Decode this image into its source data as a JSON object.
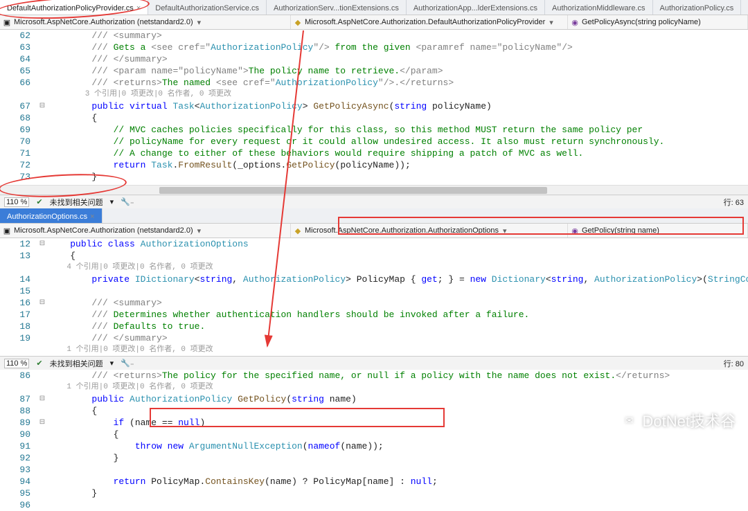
{
  "tabs_top": [
    {
      "label": "DefaultAuthorizationPolicyProvider.cs",
      "active": true,
      "closeable": true
    },
    {
      "label": "DefaultAuthorizationService.cs"
    },
    {
      "label": "AuthorizationServ...tionExtensions.cs"
    },
    {
      "label": "AuthorizationApp...lderExtensions.cs"
    },
    {
      "label": "AuthorizationMiddleware.cs"
    },
    {
      "label": "AuthorizationPolicy.cs"
    }
  ],
  "nav_top": {
    "left": "Microsoft.AspNetCore.Authorization (netstandard2.0)",
    "mid": "Microsoft.AspNetCore.Authorization.DefaultAuthorizationPolicyProvider",
    "right": "GetPolicyAsync(string policyName)"
  },
  "pane1": {
    "lines": [
      {
        "n": 62,
        "codelens": null,
        "html": "<span class='c-xml'>/// &lt;summary&gt;</span>"
      },
      {
        "n": 63,
        "html": "<span class='c-xml'>/// </span><span class='c-comment'>Gets a </span><span class='c-xml'>&lt;see cref=\"</span><span class='c-type'>AuthorizationPolicy</span><span class='c-xml'>\"/&gt;</span><span class='c-comment'> from the given </span><span class='c-xml'>&lt;paramref name=\"</span><span class='c-xmlattr'>policyName</span><span class='c-xml'>\"/&gt;</span>"
      },
      {
        "n": 64,
        "html": "<span class='c-xml'>/// &lt;/summary&gt;</span>"
      },
      {
        "n": 65,
        "html": "<span class='c-xml'>/// &lt;param name=\"</span><span class='c-xmlattr'>policyName</span><span class='c-xml'>\"&gt;</span><span class='c-comment'>The policy name to retrieve.</span><span class='c-xml'>&lt;/param&gt;</span>"
      },
      {
        "n": 66,
        "html": "<span class='c-xml'>/// &lt;returns&gt;</span><span class='c-comment'>The named </span><span class='c-xml'>&lt;see cref=\"</span><span class='c-type'>AuthorizationPolicy</span><span class='c-xml'>\"/&gt;.</span><span class='c-xml'>&lt;/returns&gt;</span>"
      },
      {
        "n": null,
        "codelens": "3 个引用|0 项更改|0 名作者, 0 项更改"
      },
      {
        "n": 67,
        "fold": "⊟",
        "html": "<span class='c-kw'>public</span> <span class='c-kw'>virtual</span> <span class='c-type'>Task</span>&lt;<span class='c-type'>AuthorizationPolicy</span>&gt; <span class='c-method'>GetPolicyAsync</span>(<span class='c-kw'>string</span> policyName)"
      },
      {
        "n": 68,
        "html": "{"
      },
      {
        "n": 69,
        "html": "    <span class='c-comment'>// MVC caches policies specifically for this class, so this method MUST return the same policy per</span>"
      },
      {
        "n": 70,
        "html": "    <span class='c-comment'>// policyName for every request or it could allow undesired access. It also must return synchronously.</span>"
      },
      {
        "n": 71,
        "html": "    <span class='c-comment'>// A change to either of these behaviors would require shipping a patch of MVC as well.</span>"
      },
      {
        "n": 72,
        "html": "    <span class='c-kw'>return</span> <span class='c-type'>Task</span>.<span class='c-method'>FromResult</span>(_options.<span class='c-method'>GetPolicy</span>(policyName));"
      },
      {
        "n": 73,
        "html": "}"
      }
    ],
    "zoom": "110 %",
    "issues": "未找到相关问题",
    "col": "行: 63"
  },
  "tabs_mid": [
    {
      "label": "AuthorizationOptions.cs",
      "active_blue": true,
      "closeable": true
    }
  ],
  "nav_mid": {
    "left": "Microsoft.AspNetCore.Authorization (netstandard2.0)",
    "mid": "Microsoft.AspNetCore.Authorization.AuthorizationOptions",
    "right": "GetPolicy(string name)"
  },
  "pane2": {
    "lines": [
      {
        "n": 12,
        "fold": "⊟",
        "html": "<span class='c-kw'>public</span> <span class='c-kw'>class</span> <span class='c-type'>AuthorizationOptions</span>"
      },
      {
        "n": 13,
        "html": "{"
      },
      {
        "n": null,
        "codelens": "4 个引用|0 项更改|0 名作者, 0 项更改"
      },
      {
        "n": 14,
        "html": "    <span class='c-kw'>private</span> <span class='c-type'>IDictionary</span>&lt;<span class='c-kw'>string</span>, <span class='c-type'>AuthorizationPolicy</span>&gt; PolicyMap { <span class='c-kw'>get</span>; } = <span class='c-kw'>new</span> <span class='c-type'>Dictionary</span>&lt;<span class='c-kw'>string</span>, <span class='c-type'>AuthorizationPolicy</span>&gt;(<span class='c-type'>StringComparer</span>.Ord"
      },
      {
        "n": 15,
        "html": ""
      },
      {
        "n": 16,
        "fold": "⊟",
        "html": "    <span class='c-xml'>/// &lt;summary&gt;</span>"
      },
      {
        "n": 17,
        "html": "    <span class='c-xml'>/// </span><span class='c-comment'>Determines whether authentication handlers should be invoked after a failure.</span>"
      },
      {
        "n": 18,
        "html": "    <span class='c-xml'>/// </span><span class='c-comment'>Defaults to true.</span>"
      },
      {
        "n": 19,
        "html": "    <span class='c-xml'>/// &lt;/summary&gt;</span>"
      },
      {
        "n": null,
        "codelens": "1 个引用|0 项更改|0 名作者, 0 项更改"
      }
    ],
    "zoom": "110 %",
    "issues": "未找到相关问题",
    "col": "行: 80"
  },
  "pane3": {
    "lines": [
      {
        "n": 86,
        "html": "    <span class='c-xml'>/// &lt;returns&gt;</span><span class='c-comment'>The policy for the specified name, or null if a policy with the name does not exist.</span><span class='c-xml'>&lt;/returns&gt;</span>"
      },
      {
        "n": null,
        "codelens": "1 个引用|0 项更改|0 名作者, 0 项更改"
      },
      {
        "n": 87,
        "fold": "⊟",
        "html": "    <span class='c-kw'>public</span> <span class='c-type'>AuthorizationPolicy</span> <span class='c-method'>GetPolicy</span>(<span class='c-kw'>string</span> name)"
      },
      {
        "n": 88,
        "html": "    {"
      },
      {
        "n": 89,
        "fold": "⊟",
        "html": "        <span class='c-kw'>if</span> (name == <span class='c-kw'>null</span>)"
      },
      {
        "n": 90,
        "html": "        {"
      },
      {
        "n": 91,
        "html": "            <span class='c-kw'>throw</span> <span class='c-kw'>new</span> <span class='c-type'>ArgumentNullException</span>(<span class='c-kw'>nameof</span>(name));"
      },
      {
        "n": 92,
        "html": "        }"
      },
      {
        "n": 93,
        "html": ""
      },
      {
        "n": 94,
        "marker": "✎",
        "html": "        <span class='c-kw'>return</span> PolicyMap.<span class='c-method'>ContainsKey</span>(name) ? PolicyMap[name] : <span class='c-kw'>null</span>;"
      },
      {
        "n": 95,
        "html": "    }"
      },
      {
        "n": 96,
        "html": ""
      }
    ]
  },
  "watermark": "DotNet技术谷"
}
